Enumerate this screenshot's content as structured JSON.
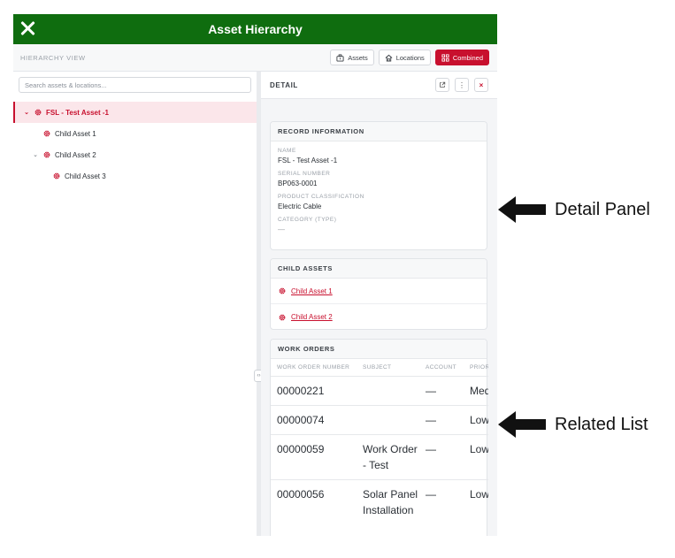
{
  "app": {
    "title": "Asset Hierarchy",
    "close_icon": "close-icon"
  },
  "subheader": {
    "label": "HIERARCHY VIEW",
    "views": [
      {
        "label": "Assets",
        "icon": "asset-icon",
        "active": false
      },
      {
        "label": "Locations",
        "icon": "home-icon",
        "active": false
      },
      {
        "label": "Combined",
        "icon": "grid-icon",
        "active": true
      }
    ]
  },
  "search": {
    "placeholder": "Search assets & locations..."
  },
  "tree": [
    {
      "label": "FSL - Test Asset -1",
      "depth": 0,
      "expanded": true,
      "selected": true
    },
    {
      "label": "Child Asset 1",
      "depth": 1,
      "expanded": false,
      "selected": false
    },
    {
      "label": "Child Asset 2",
      "depth": 1,
      "expanded": true,
      "selected": false
    },
    {
      "label": "Child Asset 3",
      "depth": 2,
      "expanded": false,
      "selected": false
    }
  ],
  "detail": {
    "header": "DETAIL",
    "record": {
      "title": "RECORD INFORMATION",
      "fields": [
        {
          "label": "NAME",
          "value": "FSL - Test Asset -1"
        },
        {
          "label": "SERIAL NUMBER",
          "value": "BP063-0001"
        },
        {
          "label": "PRODUCT CLASSIFICATION",
          "value": "Electric Cable"
        },
        {
          "label": "CATEGORY (TYPE)",
          "value": "—"
        }
      ]
    },
    "child_assets": {
      "title": "CHILD ASSETS",
      "items": [
        "Child Asset 1",
        "Child Asset 2"
      ]
    },
    "work_orders": {
      "title": "WORK ORDERS",
      "columns": [
        "WORK ORDER NUMBER",
        "SUBJECT",
        "ACCOUNT",
        "PRIORITY"
      ],
      "rows": [
        {
          "number": "00000221",
          "subject": "",
          "account": "—",
          "priority": "Medium"
        },
        {
          "number": "00000074",
          "subject": "",
          "account": "—",
          "priority": "Low"
        },
        {
          "number": "00000059",
          "subject": "Work Order - Test",
          "account": "—",
          "priority": "Low"
        },
        {
          "number": "00000056",
          "subject": "Solar Panel Installation",
          "account": "—",
          "priority": "Low"
        }
      ]
    }
  },
  "annotations": [
    {
      "label": "Detail Panel"
    },
    {
      "label": "Related List"
    }
  ],
  "colors": {
    "header_green": "#0f6d0f",
    "accent_red": "#c8102e"
  }
}
